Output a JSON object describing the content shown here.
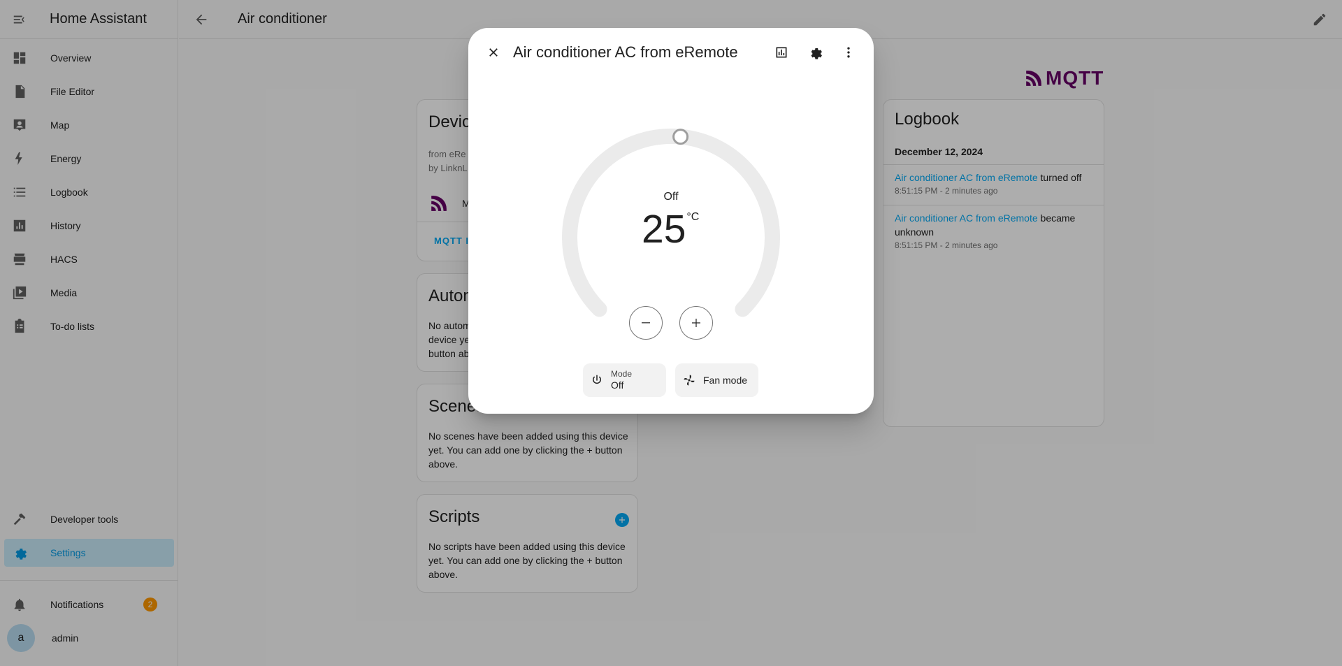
{
  "sidebar": {
    "title": "Home Assistant",
    "items": [
      {
        "label": "Overview",
        "icon": "overview-icon"
      },
      {
        "label": "File Editor",
        "icon": "file-icon"
      },
      {
        "label": "Map",
        "icon": "map-icon"
      },
      {
        "label": "Energy",
        "icon": "lightning-icon"
      },
      {
        "label": "Logbook",
        "icon": "logbook-icon"
      },
      {
        "label": "History",
        "icon": "history-icon"
      },
      {
        "label": "HACS",
        "icon": "hacs-icon"
      },
      {
        "label": "Media",
        "icon": "media-icon"
      },
      {
        "label": "To-do lists",
        "icon": "todo-icon"
      }
    ],
    "developer_tools": "Developer tools",
    "settings": "Settings",
    "notifications": {
      "label": "Notifications",
      "count": "2"
    },
    "user": {
      "initial": "a",
      "name": "admin"
    }
  },
  "topbar": {
    "title": "Air conditioner"
  },
  "device_card": {
    "title_partial": "Devic",
    "info_line1": "from eRe",
    "info_line2": "by LinknL",
    "integration_partial": "M",
    "action_partial": "MQTT IN"
  },
  "automations_card": {
    "title_partial": "Autom",
    "lines": [
      "No autom",
      "device ye",
      "button ab"
    ]
  },
  "scenes_card": {
    "title_partial": "Scenes",
    "lines": [
      "No scenes have been added using this device",
      "yet. You can add one by clicking the + button",
      "above."
    ]
  },
  "scripts_card": {
    "title": "Scripts",
    "lines": [
      "No scripts have been added using this device",
      "yet. You can add one by clicking the + button",
      "above."
    ]
  },
  "mqtt_logo": "MQTT",
  "logbook": {
    "title": "Logbook",
    "date": "December 12, 2024",
    "entries": [
      {
        "link": "Air conditioner AC from eRemote",
        "text_inline": " turned off",
        "text_wrap": "",
        "time": "8:51:15 PM - 2 minutes ago"
      },
      {
        "link": "Air conditioner AC from eRemote",
        "text_inline": " became",
        "text_wrap": "unknown",
        "time": "8:51:15 PM - 2 minutes ago"
      }
    ]
  },
  "dialog": {
    "title": "Air conditioner AC from eRemote",
    "state": "Off",
    "target_temperature": "25",
    "unit": "°C",
    "setpoint_fraction": 0.52,
    "mode_chip": {
      "label": "Mode",
      "value": "Off"
    },
    "fan_chip": {
      "label": "Fan mode"
    }
  },
  "colors": {
    "accent": "#03a9f4",
    "mqtt": "#660066",
    "badge": "#ff9800"
  }
}
